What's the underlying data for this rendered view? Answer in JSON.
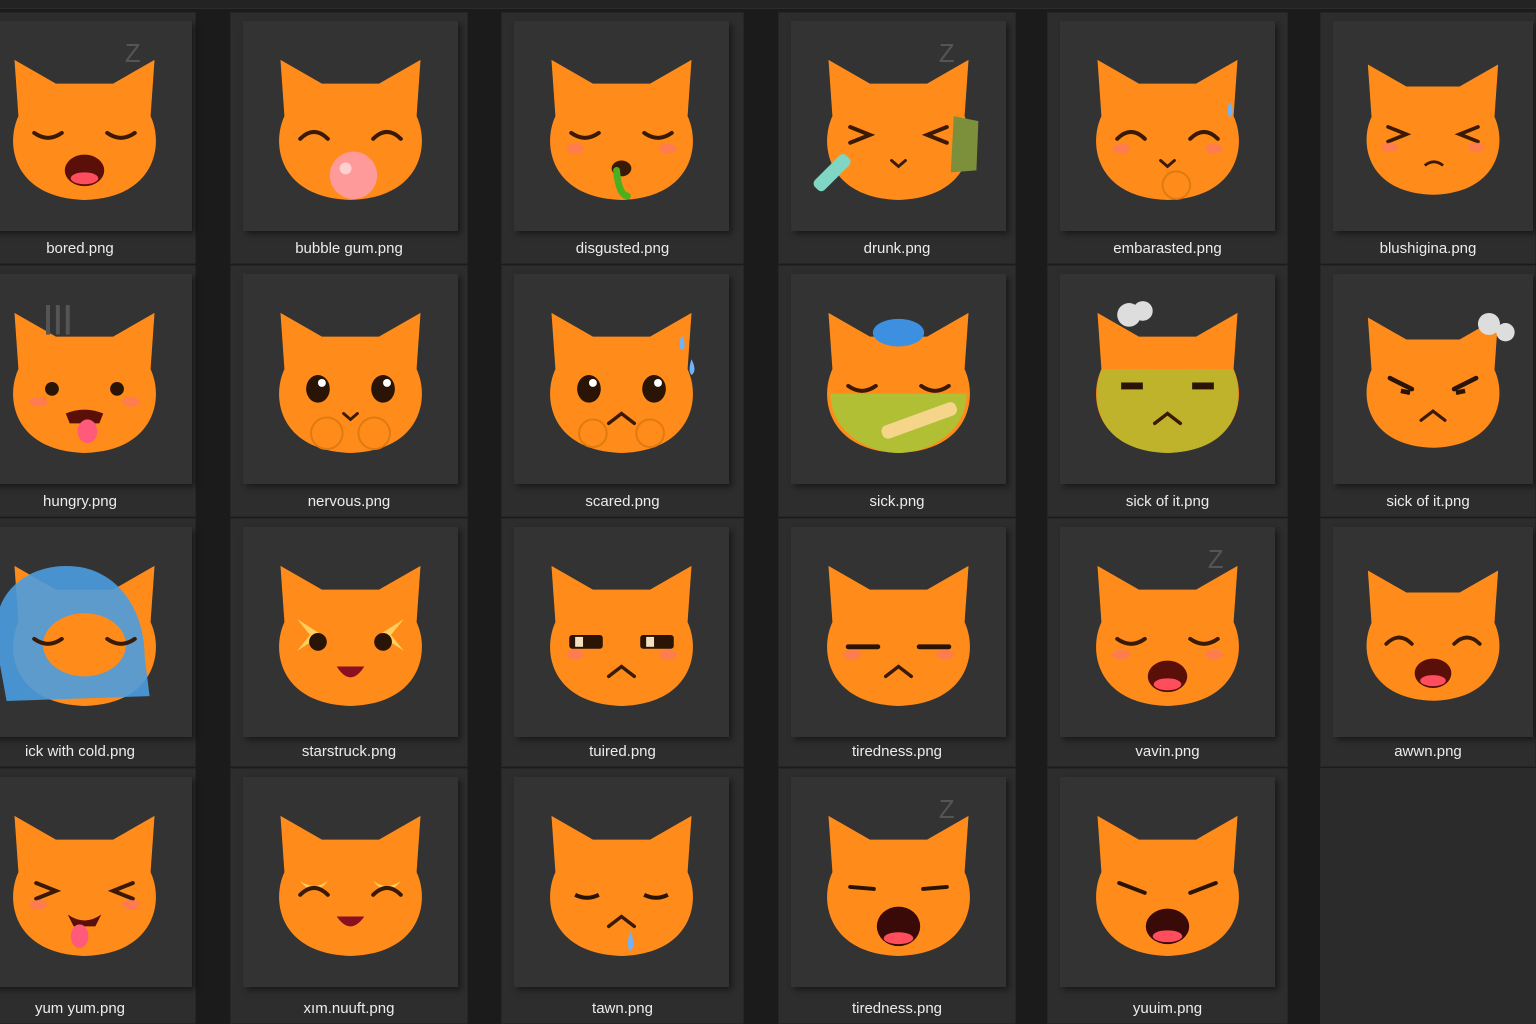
{
  "files": [
    {
      "name": "bored.png",
      "icon": "cat-bored-icon"
    },
    {
      "name": "bubble gum.png",
      "icon": "cat-bubble-gum-icon"
    },
    {
      "name": "disgusted.png",
      "icon": "cat-disgusted-icon"
    },
    {
      "name": "drunk.png",
      "icon": "cat-drunk-icon"
    },
    {
      "name": "embarasted.png",
      "icon": "cat-embarrassed-icon"
    },
    {
      "name": "blushigina.png",
      "icon": "cat-blushing-icon"
    },
    {
      "name": "hungry.png",
      "icon": "cat-hungry-icon"
    },
    {
      "name": "nervous.png",
      "icon": "cat-nervous-icon"
    },
    {
      "name": "scared.png",
      "icon": "cat-scared-icon"
    },
    {
      "name": "sick.png",
      "icon": "cat-sick-icon"
    },
    {
      "name": "sick of it.png",
      "icon": "cat-sick-of-it-icon"
    },
    {
      "name": "sick of it.png",
      "icon": "cat-annoyed-icon"
    },
    {
      "name": "ick with cold.png",
      "icon": "cat-sick-with-cold-icon"
    },
    {
      "name": "starstruck.png",
      "icon": "cat-starstruck-icon"
    },
    {
      "name": "tuired.png",
      "icon": "cat-tired-icon"
    },
    {
      "name": "tiredness.png",
      "icon": "cat-tiredness-icon"
    },
    {
      "name": "vavin.png",
      "icon": "cat-yawning-icon"
    },
    {
      "name": "awwn.png",
      "icon": "cat-yawn-icon"
    },
    {
      "name": "yum yum.png",
      "icon": "cat-yum-icon"
    },
    {
      "name": "xım.nuuft.png",
      "icon": "cat-laughing-icon"
    },
    {
      "name": "tawn.png",
      "icon": "cat-sad-tear-icon"
    },
    {
      "name": "tiredness.png",
      "icon": "cat-sleepy-yawn-icon"
    },
    {
      "name": "yuuim.png",
      "icon": "cat-shout-icon"
    }
  ],
  "colors": {
    "cat": "#ff8c1a",
    "background": "#1b1b1b",
    "tile": "#2d2d2d",
    "thumb": "#333333",
    "label": "#ececec"
  }
}
